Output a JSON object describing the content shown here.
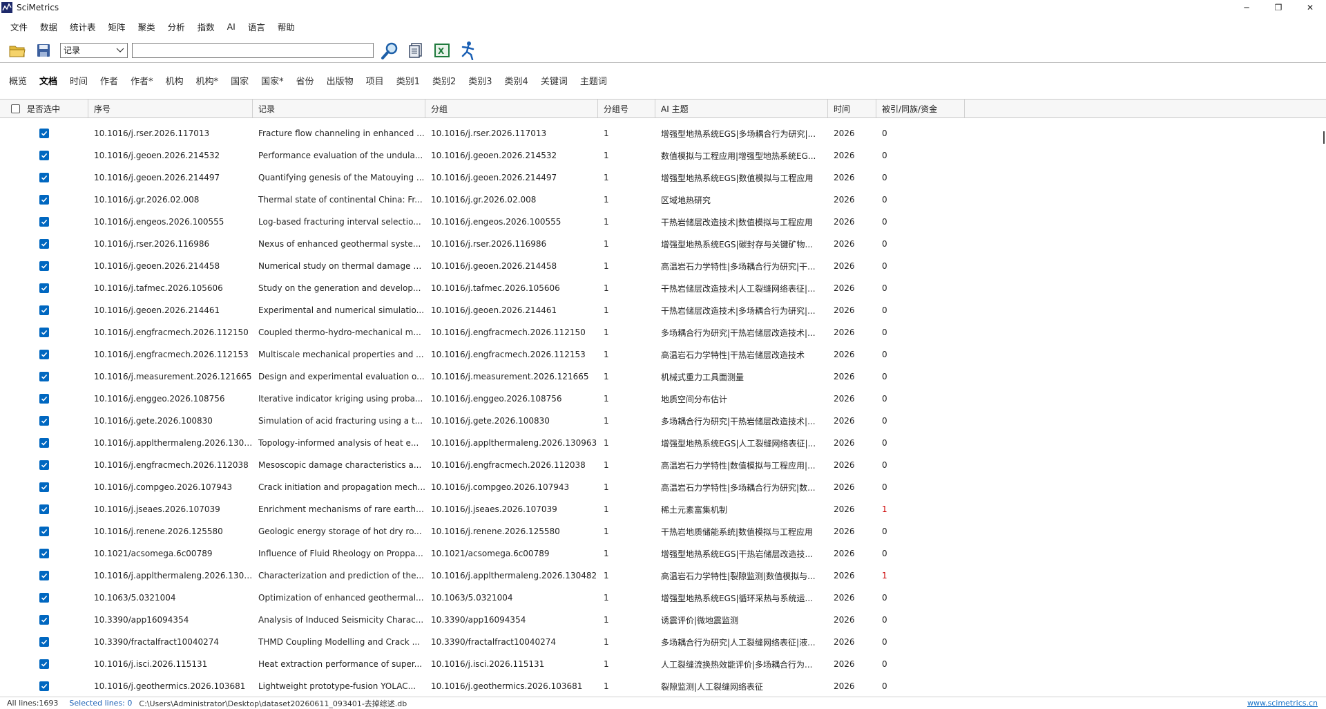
{
  "window": {
    "title": "SciMetrics",
    "controls": [
      "─",
      "❐",
      "✕"
    ]
  },
  "menu": [
    "文件",
    "数据",
    "统计表",
    "矩阵",
    "聚类",
    "分析",
    "指数",
    "AI",
    "语言",
    "帮助"
  ],
  "toolbar": {
    "select_value": "记录",
    "search_value": "",
    "icons": [
      "open-folder-icon",
      "save-icon",
      "search-icon",
      "document-icon",
      "excel-export-icon",
      "run-icon"
    ]
  },
  "tabs": [
    "概览",
    "文档",
    "时间",
    "作者",
    "作者*",
    "机构",
    "机构*",
    "国家",
    "国家*",
    "省份",
    "出版物",
    "项目",
    "类别1",
    "类别2",
    "类别3",
    "类别4",
    "关键词",
    "主题词"
  ],
  "active_tab": "文档",
  "table": {
    "columns": [
      "是否选中",
      "序号",
      "记录",
      "分组",
      "分组号",
      "AI 主题",
      "时间",
      "被引/同族/资金"
    ],
    "rows": [
      [
        "10.1016/j.rser.2026.117013",
        "Fracture flow channeling in enhanced ...",
        "10.1016/j.rser.2026.117013",
        "1",
        "增强型地热系统EGS|多场耦合行为研究|...",
        "2026",
        "0"
      ],
      [
        "10.1016/j.geoen.2026.214532",
        "Performance evaluation of the undula...",
        "10.1016/j.geoen.2026.214532",
        "1",
        "数值模拟与工程应用|增强型地热系统EG...",
        "2026",
        "0"
      ],
      [
        "10.1016/j.geoen.2026.214497",
        "Quantifying genesis of the Matouying ...",
        "10.1016/j.geoen.2026.214497",
        "1",
        "增强型地热系统EGS|数值模拟与工程应用",
        "2026",
        "0"
      ],
      [
        "10.1016/j.gr.2026.02.008",
        "Thermal state of continental China: Fr...",
        "10.1016/j.gr.2026.02.008",
        "1",
        "区域地热研究",
        "2026",
        "0"
      ],
      [
        "10.1016/j.engeos.2026.100555",
        "Log-based fracturing interval selectio...",
        "10.1016/j.engeos.2026.100555",
        "1",
        "干热岩储层改造技术|数值模拟与工程应用",
        "2026",
        "0"
      ],
      [
        "10.1016/j.rser.2026.116986",
        "Nexus of enhanced geothermal syste...",
        "10.1016/j.rser.2026.116986",
        "1",
        "增强型地热系统EGS|碳封存与关键矿物...",
        "2026",
        "0"
      ],
      [
        "10.1016/j.geoen.2026.214458",
        "Numerical study on thermal damage o...",
        "10.1016/j.geoen.2026.214458",
        "1",
        "高温岩石力学特性|多场耦合行为研究|干...",
        "2026",
        "0"
      ],
      [
        "10.1016/j.tafmec.2026.105606",
        "Study on the generation and develop...",
        "10.1016/j.tafmec.2026.105606",
        "1",
        "干热岩储层改造技术|人工裂缝网络表征|...",
        "2026",
        "0"
      ],
      [
        "10.1016/j.geoen.2026.214461",
        "Experimental and numerical simulatio...",
        "10.1016/j.geoen.2026.214461",
        "1",
        "干热岩储层改造技术|多场耦合行为研究|...",
        "2026",
        "0"
      ],
      [
        "10.1016/j.engfracmech.2026.112150",
        "Coupled thermo-hydro-mechanical m...",
        "10.1016/j.engfracmech.2026.112150",
        "1",
        "多场耦合行为研究|干热岩储层改造技术|...",
        "2026",
        "0"
      ],
      [
        "10.1016/j.engfracmech.2026.112153",
        "Multiscale mechanical properties and ...",
        "10.1016/j.engfracmech.2026.112153",
        "1",
        "高温岩石力学特性|干热岩储层改造技术",
        "2026",
        "0"
      ],
      [
        "10.1016/j.measurement.2026.121665",
        "Design and experimental evaluation o...",
        "10.1016/j.measurement.2026.121665",
        "1",
        "机械式重力工具面测量",
        "2026",
        "0"
      ],
      [
        "10.1016/j.enggeo.2026.108756",
        "Iterative indicator kriging using proba...",
        "10.1016/j.enggeo.2026.108756",
        "1",
        "地质空间分布估计",
        "2026",
        "0"
      ],
      [
        "10.1016/j.gete.2026.100830",
        "Simulation of acid fracturing using a t...",
        "10.1016/j.gete.2026.100830",
        "1",
        "多场耦合行为研究|干热岩储层改造技术|...",
        "2026",
        "0"
      ],
      [
        "10.1016/j.applthermaleng.2026.130963",
        "Topology-informed analysis of heat e...",
        "10.1016/j.applthermaleng.2026.130963",
        "1",
        "增强型地热系统EGS|人工裂缝网络表征|...",
        "2026",
        "0"
      ],
      [
        "10.1016/j.engfracmech.2026.112038",
        "Mesoscopic damage characteristics a...",
        "10.1016/j.engfracmech.2026.112038",
        "1",
        "高温岩石力学特性|数值模拟与工程应用|...",
        "2026",
        "0"
      ],
      [
        "10.1016/j.compgeo.2026.107943",
        "Crack initiation and propagation mech...",
        "10.1016/j.compgeo.2026.107943",
        "1",
        "高温岩石力学特性|多场耦合行为研究|数...",
        "2026",
        "0"
      ],
      [
        "10.1016/j.jseaes.2026.107039",
        "Enrichment mechanisms of rare earth ...",
        "10.1016/j.jseaes.2026.107039",
        "1",
        "稀土元素富集机制",
        "2026",
        "1"
      ],
      [
        "10.1016/j.renene.2026.125580",
        "Geologic energy storage of hot dry ro...",
        "10.1016/j.renene.2026.125580",
        "1",
        "干热岩地质储能系统|数值模拟与工程应用",
        "2026",
        "0"
      ],
      [
        "10.1021/acsomega.6c00789",
        "Influence of Fluid Rheology on Proppa...",
        "10.1021/acsomega.6c00789",
        "1",
        "增强型地热系统EGS|干热岩储层改造技...",
        "2026",
        "0"
      ],
      [
        "10.1016/j.applthermaleng.2026.130482",
        "Characterization and prediction of the...",
        "10.1016/j.applthermaleng.2026.130482",
        "1",
        "高温岩石力学特性|裂隙监测|数值模拟与...",
        "2026",
        "1"
      ],
      [
        "10.1063/5.0321004",
        "Optimization of enhanced geothermal...",
        "10.1063/5.0321004",
        "1",
        "增强型地热系统EGS|循环采热与系统运...",
        "2026",
        "0"
      ],
      [
        "10.3390/app16094354",
        "Analysis of Induced Seismicity Charac...",
        "10.3390/app16094354",
        "1",
        "诱震评价|微地震监测",
        "2026",
        "0"
      ],
      [
        "10.3390/fractalfract10040274",
        "THMD Coupling Modelling and Crack ...",
        "10.3390/fractalfract10040274",
        "1",
        "多场耦合行为研究|人工裂缝网络表征|液...",
        "2026",
        "0"
      ],
      [
        "10.1016/j.isci.2026.115131",
        "Heat extraction performance of super...",
        "10.1016/j.isci.2026.115131",
        "1",
        "人工裂缝流换热效能评价|多场耦合行为...",
        "2026",
        "0"
      ],
      [
        "10.1016/j.geothermics.2026.103681",
        "Lightweight prototype-fusion YOLAC...",
        "10.1016/j.geothermics.2026.103681",
        "1",
        "裂隙监测|人工裂缝网络表征",
        "2026",
        "0"
      ]
    ]
  },
  "status": {
    "all_lines": "All lines:1693",
    "selected_lines": "Selected lines: 0",
    "path": "C:\\Users\\Administrator\\Desktop\\dataset20260611_093401-去掉综述.db",
    "link": "www.scimetrics.cn"
  },
  "colors": {
    "checkbox": "#0067c0",
    "link": "#1a73c8",
    "accent_red": "#cc0000"
  }
}
